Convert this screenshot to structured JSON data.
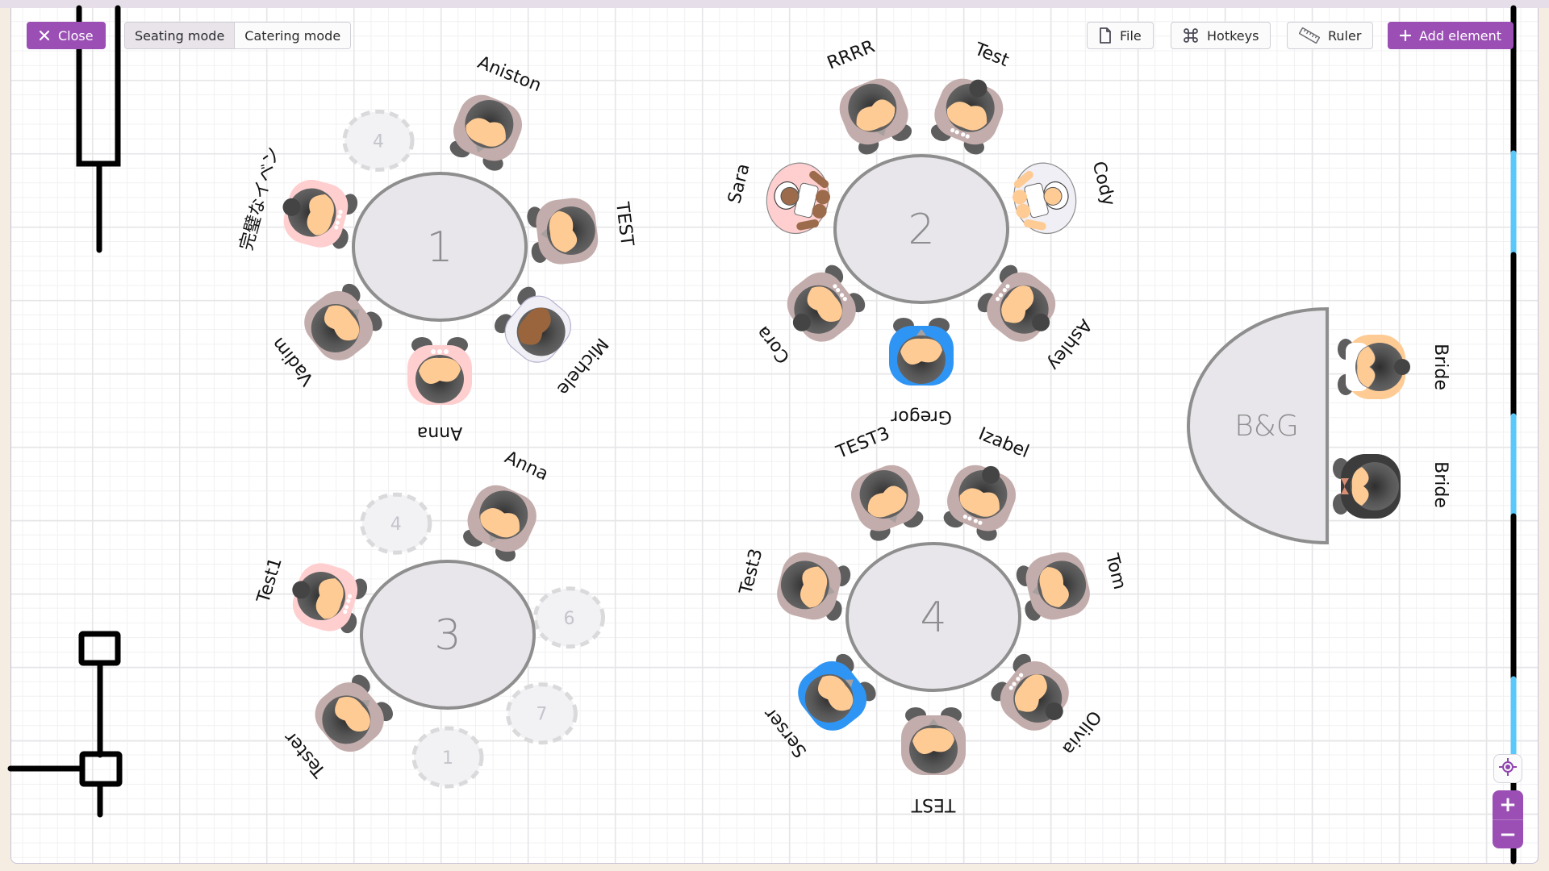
{
  "toolbar": {
    "close_label": "Close",
    "close_icon": "close-icon",
    "modes": [
      {
        "label": "Seating mode",
        "active": true
      },
      {
        "label": "Catering mode",
        "active": false
      }
    ],
    "file_label": "File",
    "file_icon": "file-icon",
    "hotkeys_label": "Hotkeys",
    "hotkeys_icon": "command-icon",
    "ruler_label": "Ruler",
    "ruler_icon": "ruler-icon",
    "add_element_label": "Add element",
    "add_element_icon": "plus-icon"
  },
  "colors": {
    "accent": "#9b4fb5",
    "table_fill": "#e8e6ea",
    "table_stroke": "#8e8e8e",
    "window": "#5ac8fa",
    "wall": "#000000",
    "skin": "#ffcb94",
    "hair": "#5a5a5a",
    "shirt_default": "#c3adac",
    "shirt_pink": "#ffcfd0",
    "shirt_blue": "#2f95f5",
    "shirt_white": "#f0eff5"
  },
  "tables": [
    {
      "number": "1",
      "seats": [
        {
          "name": "Aniston",
          "type": "man",
          "shirt": "default"
        },
        {
          "name": "TEST",
          "type": "man",
          "shirt": "default"
        },
        {
          "name": "Michele",
          "type": "woman-white",
          "shirt": "white"
        },
        {
          "name": "Anna",
          "type": "woman",
          "shirt": "pink"
        },
        {
          "name": "Vadim",
          "type": "man",
          "shirt": "default"
        },
        {
          "name": "完璧なイベン",
          "type": "woman-bun",
          "shirt": "pink"
        }
      ],
      "empty_seats": [
        "4"
      ]
    },
    {
      "number": "2",
      "seats": [
        {
          "name": "RRRR",
          "type": "man",
          "shirt": "default"
        },
        {
          "name": "Test",
          "type": "woman-bun",
          "shirt": "default"
        },
        {
          "name": "Cody",
          "type": "child",
          "shirt": "white"
        },
        {
          "name": "Ashley",
          "type": "woman-bun",
          "shirt": "default"
        },
        {
          "name": "Gregor",
          "type": "man",
          "shirt": "blue"
        },
        {
          "name": "Cora",
          "type": "woman-bun",
          "shirt": "default"
        },
        {
          "name": "Sara",
          "type": "child",
          "shirt": "pink"
        }
      ],
      "empty_seats": []
    },
    {
      "number": "3",
      "seats": [
        {
          "name": "Anna",
          "type": "man",
          "shirt": "default"
        },
        {
          "name": "Tester",
          "type": "man",
          "shirt": "default"
        },
        {
          "name": "Test1",
          "type": "woman-bun",
          "shirt": "pink"
        }
      ],
      "empty_seats": [
        "4",
        "6",
        "7",
        "1"
      ]
    },
    {
      "number": "4",
      "seats": [
        {
          "name": "TEST3",
          "type": "man",
          "shirt": "default"
        },
        {
          "name": "Izabel",
          "type": "woman-bun",
          "shirt": "default"
        },
        {
          "name": "Tom",
          "type": "man",
          "shirt": "default"
        },
        {
          "name": "Olivia",
          "type": "woman-bun",
          "shirt": "default"
        },
        {
          "name": "TEST",
          "type": "man",
          "shirt": "default"
        },
        {
          "name": "Serser",
          "type": "man",
          "shirt": "blue"
        },
        {
          "name": "Test3",
          "type": "man",
          "shirt": "default"
        }
      ],
      "empty_seats": []
    },
    {
      "number": "B&G",
      "seats": [
        {
          "name": "Bride",
          "type": "bride",
          "shirt": "white"
        },
        {
          "name": "Bride",
          "type": "groom",
          "shirt": "black"
        }
      ],
      "empty_seats": []
    }
  ],
  "map_controls": {
    "locate_icon": "locate-icon",
    "zoom_in": "+",
    "zoom_out": "−"
  }
}
